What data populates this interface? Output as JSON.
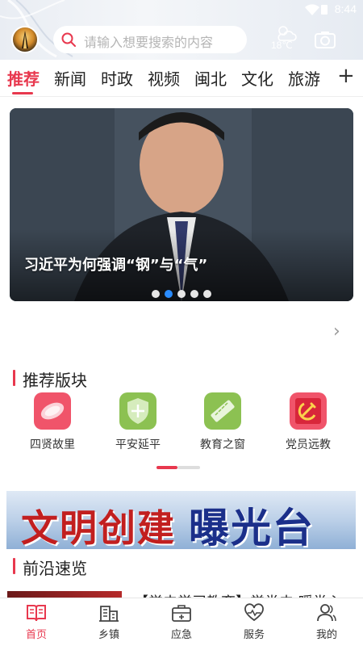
{
  "status_bar": {
    "time": "8:44"
  },
  "header": {
    "search_placeholder": "请输入想要搜索的内容",
    "weather_temp": "18℃"
  },
  "tabs": [
    {
      "label": "推荐",
      "active": true
    },
    {
      "label": "新闻"
    },
    {
      "label": "时政"
    },
    {
      "label": "视频"
    },
    {
      "label": "闽北"
    },
    {
      "label": "文化"
    },
    {
      "label": "旅游"
    }
  ],
  "banner": {
    "caption": "习近平为何强调“钢”与“气”",
    "slide_count": 5,
    "active_slide": 2
  },
  "recommend_section": {
    "title": "推荐版块",
    "items": [
      {
        "label": "四贤故里",
        "color": "#f0546a"
      },
      {
        "label": "平安延平",
        "color": "#8cc152"
      },
      {
        "label": "教育之窗",
        "color": "#8cc152"
      },
      {
        "label": "党员远教",
        "color": "#f0546a"
      }
    ]
  },
  "promo": {
    "text_red": "文明创建",
    "text_blue": "曝光台"
  },
  "frontline_section": {
    "title": "前沿速览",
    "first_title": "【学史学习教育】学党史 暖党心"
  },
  "bottom_nav": [
    {
      "label": "首页",
      "active": true
    },
    {
      "label": "乡镇"
    },
    {
      "label": "应急"
    },
    {
      "label": "服务"
    },
    {
      "label": "我的"
    }
  ],
  "colors": {
    "accent": "#e8384e",
    "dot_active": "#2a8cff"
  }
}
